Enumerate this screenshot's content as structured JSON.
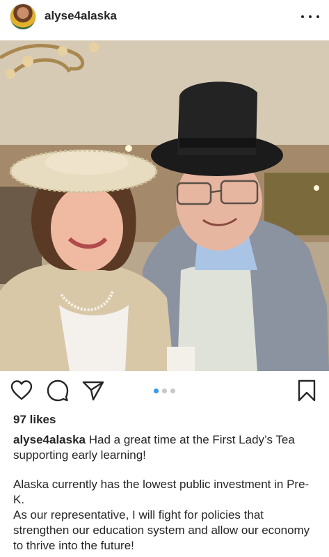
{
  "post": {
    "username": "alyse4alaska",
    "avatar_icon": "profile-photo",
    "more_icon": "ellipsis-horizontal",
    "likes": "97 likes",
    "carousel": {
      "count": 3,
      "active_index": 0
    },
    "caption": {
      "first_line": "Had a great time at the First Lady’s Tea supporting early learning!",
      "paragraph_2": "Alaska currently has the lowest public investment in Pre-K.",
      "paragraph_3": "As our representative, I will fight for policies that strengthen our education system and allow our economy to thrive into the future!"
    }
  },
  "colors": {
    "text": "#262626",
    "accent": "#3897f0",
    "dot_inactive": "#c7c7c7"
  }
}
